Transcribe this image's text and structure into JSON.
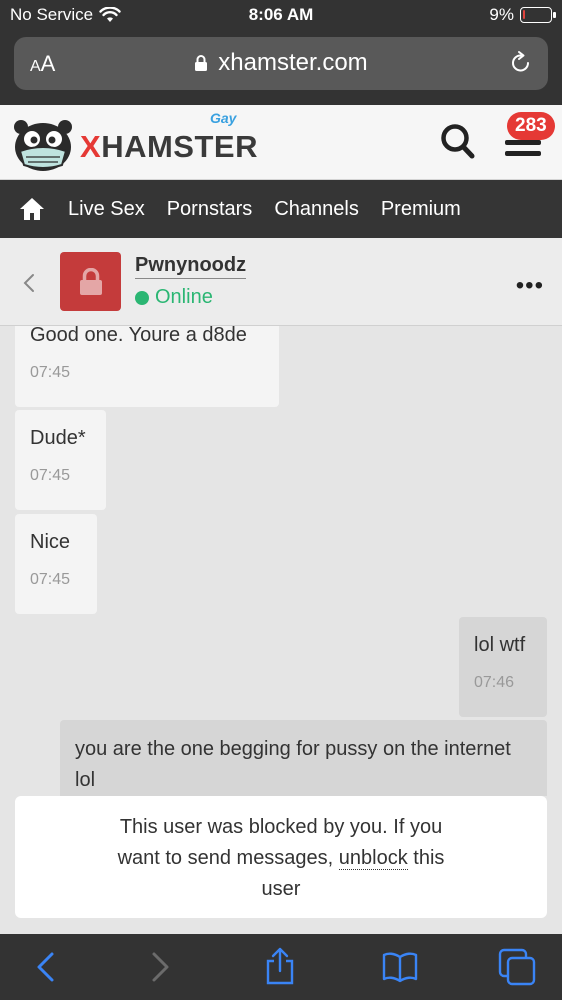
{
  "statusbar": {
    "carrier": "No Service",
    "time": "8:06 AM",
    "battery": "9%",
    "battery_level": 0.09,
    "battery_color": "#e0433d"
  },
  "browser": {
    "aa_label": "AA",
    "url": "xhamster.com"
  },
  "site": {
    "logo_x": "X",
    "logo_rest": "HAMSTER",
    "logo_tag": "Gay",
    "notification_count": "283",
    "nav_items": [
      "Live Sex",
      "Pornstars",
      "Channels",
      "Premium"
    ],
    "brand_color": "#e53935"
  },
  "chat": {
    "username": "Pwnynoodz",
    "status": "Online",
    "status_color": "#2bb673",
    "messages": [
      {
        "text": "Good one. Youre a d8de",
        "time": "07:45",
        "direction": "in"
      },
      {
        "text": "Dude*",
        "time": "07:45",
        "direction": "in"
      },
      {
        "text": "Nice",
        "time": "07:45",
        "direction": "in"
      },
      {
        "text": "lol wtf",
        "time": "07:46",
        "direction": "out"
      },
      {
        "text": "you are the one begging for pussy on the internet lol",
        "time": "",
        "direction": "out"
      }
    ],
    "blocked_notice": {
      "line1": "This user was blocked by you. If you",
      "line2_before": "want to send messages, ",
      "link": "unblock",
      "line2_after": " this",
      "line3": "user"
    }
  },
  "toolbar": {
    "icons": [
      "back-icon",
      "forward-icon",
      "share-icon",
      "bookmarks-icon",
      "tabs-icon"
    ],
    "accent": "#3a84f5"
  }
}
